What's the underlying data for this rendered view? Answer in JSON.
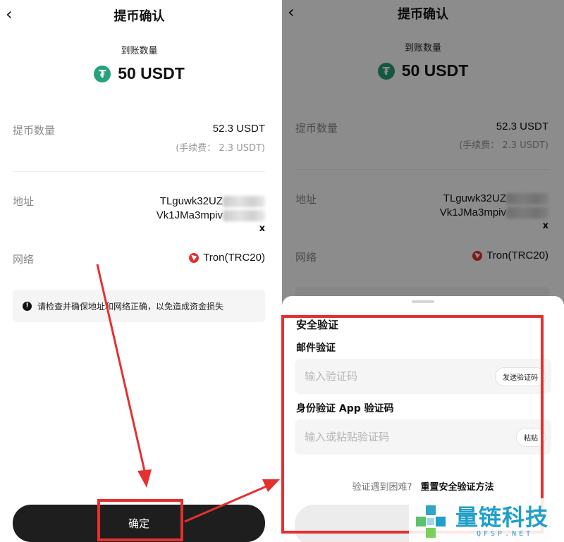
{
  "header": {
    "title": "提币确认",
    "back_icon": "‹"
  },
  "receive": {
    "label": "到账数量",
    "amount": "50 USDT",
    "coin_icon": "₮"
  },
  "withdraw": {
    "label": "提币数量",
    "value": "52.3 USDT",
    "fee": "(手续费： 2.3 USDT)"
  },
  "address": {
    "label": "地址",
    "line1": "TLguwk32UZ",
    "line2": "Vk1JMa3mpiv",
    "suffix": "x"
  },
  "network": {
    "label": "网络",
    "value": "Tron(TRC20)"
  },
  "notice": {
    "icon": "!",
    "text": "请检查并确保地址和网络正确，以免造成资金损失"
  },
  "confirm_button": "确定",
  "security": {
    "title": "安全验证",
    "email_label": "邮件验证",
    "email_placeholder": "输入验证码",
    "send_code": "发送验证码",
    "app_label": "身份验证 App 验证码",
    "app_placeholder": "输入或粘贴验证码",
    "paste": "粘贴",
    "help_question": "验证遇到困难?",
    "reset_link": "重置安全验证方法"
  },
  "watermark": {
    "name": "量链科技",
    "sub": "QFSP.NET"
  },
  "colors": {
    "annotation_red": "#e53030",
    "tether_green": "#26a17b",
    "tron_red": "#e3312f",
    "watermark_blue": "#1f9fc9"
  }
}
